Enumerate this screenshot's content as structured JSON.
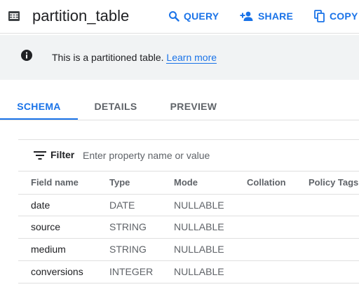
{
  "header": {
    "title": "partition_table",
    "table_icon": "table-icon",
    "actions": [
      {
        "label": "QUERY",
        "icon": "search-icon"
      },
      {
        "label": "SHARE",
        "icon": "person-add-icon"
      },
      {
        "label": "COPY",
        "icon": "copy-icon"
      }
    ]
  },
  "banner": {
    "icon": "info-icon",
    "text": "This is a partitioned table.",
    "link": "Learn more"
  },
  "tabs": [
    {
      "label": "SCHEMA",
      "active": true
    },
    {
      "label": "DETAILS",
      "active": false
    },
    {
      "label": "PREVIEW",
      "active": false
    }
  ],
  "filter": {
    "icon": "filter-list-icon",
    "label": "Filter",
    "placeholder": "Enter property name or value"
  },
  "schema": {
    "columns": [
      "Field name",
      "Type",
      "Mode",
      "Collation",
      "Policy Tags"
    ],
    "rows": [
      {
        "name": "date",
        "type": "DATE",
        "mode": "NULLABLE",
        "collation": "",
        "policy_tags": ""
      },
      {
        "name": "source",
        "type": "STRING",
        "mode": "NULLABLE",
        "collation": "",
        "policy_tags": ""
      },
      {
        "name": "medium",
        "type": "STRING",
        "mode": "NULLABLE",
        "collation": "",
        "policy_tags": ""
      },
      {
        "name": "conversions",
        "type": "INTEGER",
        "mode": "NULLABLE",
        "collation": "",
        "policy_tags": ""
      }
    ]
  },
  "colors": {
    "accent": "#1a73e8",
    "banner_bg": "#f1f3f4",
    "divider": "#e0e0e0",
    "secondary_text": "#5f6368"
  }
}
